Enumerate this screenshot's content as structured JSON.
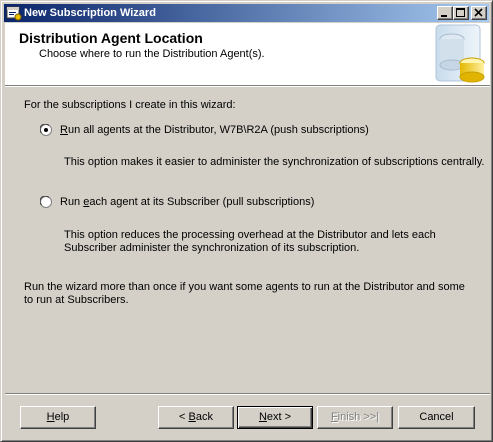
{
  "window": {
    "title": "New Subscription Wizard"
  },
  "header": {
    "title": "Distribution Agent Location",
    "subtitle": "Choose where to run the Distribution Agent(s)."
  },
  "content": {
    "intro": "For the subscriptions I create in this wizard:",
    "options": [
      {
        "label_underline": "R",
        "label_rest": "un all agents at the Distributor, W7B\\R2A (push subscriptions)",
        "selected": true,
        "description": "This option makes it easier to administer the synchronization of subscriptions centrally."
      },
      {
        "label_pre": "Run ",
        "label_underline": "e",
        "label_rest": "ach agent at its Subscriber (pull subscriptions)",
        "selected": false,
        "description": "This option reduces the processing overhead at the Distributor and lets each Subscriber administer the synchronization of its subscription."
      }
    ],
    "note": "Run the wizard more than once if you want some agents to run at the Distributor and some to run at Subscribers."
  },
  "buttons": {
    "help": {
      "underline": "H",
      "rest": "elp"
    },
    "back": {
      "prefix": "< ",
      "underline": "B",
      "rest": "ack"
    },
    "next": {
      "underline": "N",
      "rest": "ext >"
    },
    "finish": {
      "underline": "F",
      "rest": "inish >>|"
    },
    "cancel": {
      "label": "Cancel"
    }
  },
  "colors": {
    "titlebar_start": "#0a246a",
    "titlebar_end": "#a6caf0",
    "face": "#d4d0c8",
    "header_bg": "#ffffff"
  }
}
